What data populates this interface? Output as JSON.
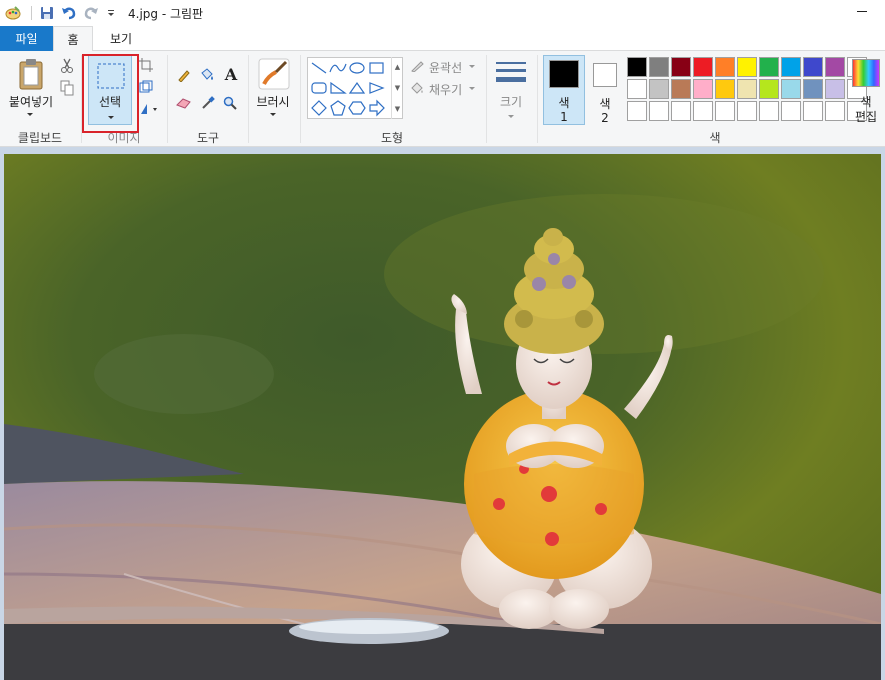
{
  "window": {
    "title": "4.jpg - 그림판",
    "quick_access": [
      "paint-app-icon",
      "save-icon",
      "undo-icon",
      "redo-icon",
      "customize-qat-icon"
    ]
  },
  "tabs": [
    {
      "label": "파일"
    },
    {
      "label": "홈"
    },
    {
      "label": "보기"
    }
  ],
  "ribbon": {
    "clipboard": {
      "paste_label": "붙여넣기",
      "group_label": "클립보드"
    },
    "image": {
      "select_label": "선택",
      "group_label": "이미지"
    },
    "tools": {
      "group_label": "도구"
    },
    "brushes": {
      "label": "브러시"
    },
    "shapes": {
      "outline_label": "윤곽선",
      "fill_label": "채우기",
      "group_label": "도형"
    },
    "size": {
      "label": "크기"
    },
    "colors": {
      "color1_label": "색",
      "color1_num": "1",
      "color2_label": "색",
      "color2_num": "2",
      "edit_label_1": "색",
      "edit_label_2": "편집",
      "group_label": "색",
      "color1_value": "#000000",
      "color2_value": "#ffffff",
      "palette_row1": [
        "#000000",
        "#7f7f7f",
        "#880015",
        "#ed1c24",
        "#ff7f27",
        "#fff200",
        "#22b14c",
        "#00a2e8",
        "#3f48cc",
        "#a349a4"
      ],
      "palette_row2": [
        "#ffffff",
        "#c3c3c3",
        "#b97a57",
        "#ffaec9",
        "#ffc90e",
        "#efe4b0",
        "#b5e61d",
        "#99d9ea",
        "#7092be",
        "#c8bfe7"
      ]
    }
  },
  "canvas": {
    "image_description": "figurine-photo"
  }
}
